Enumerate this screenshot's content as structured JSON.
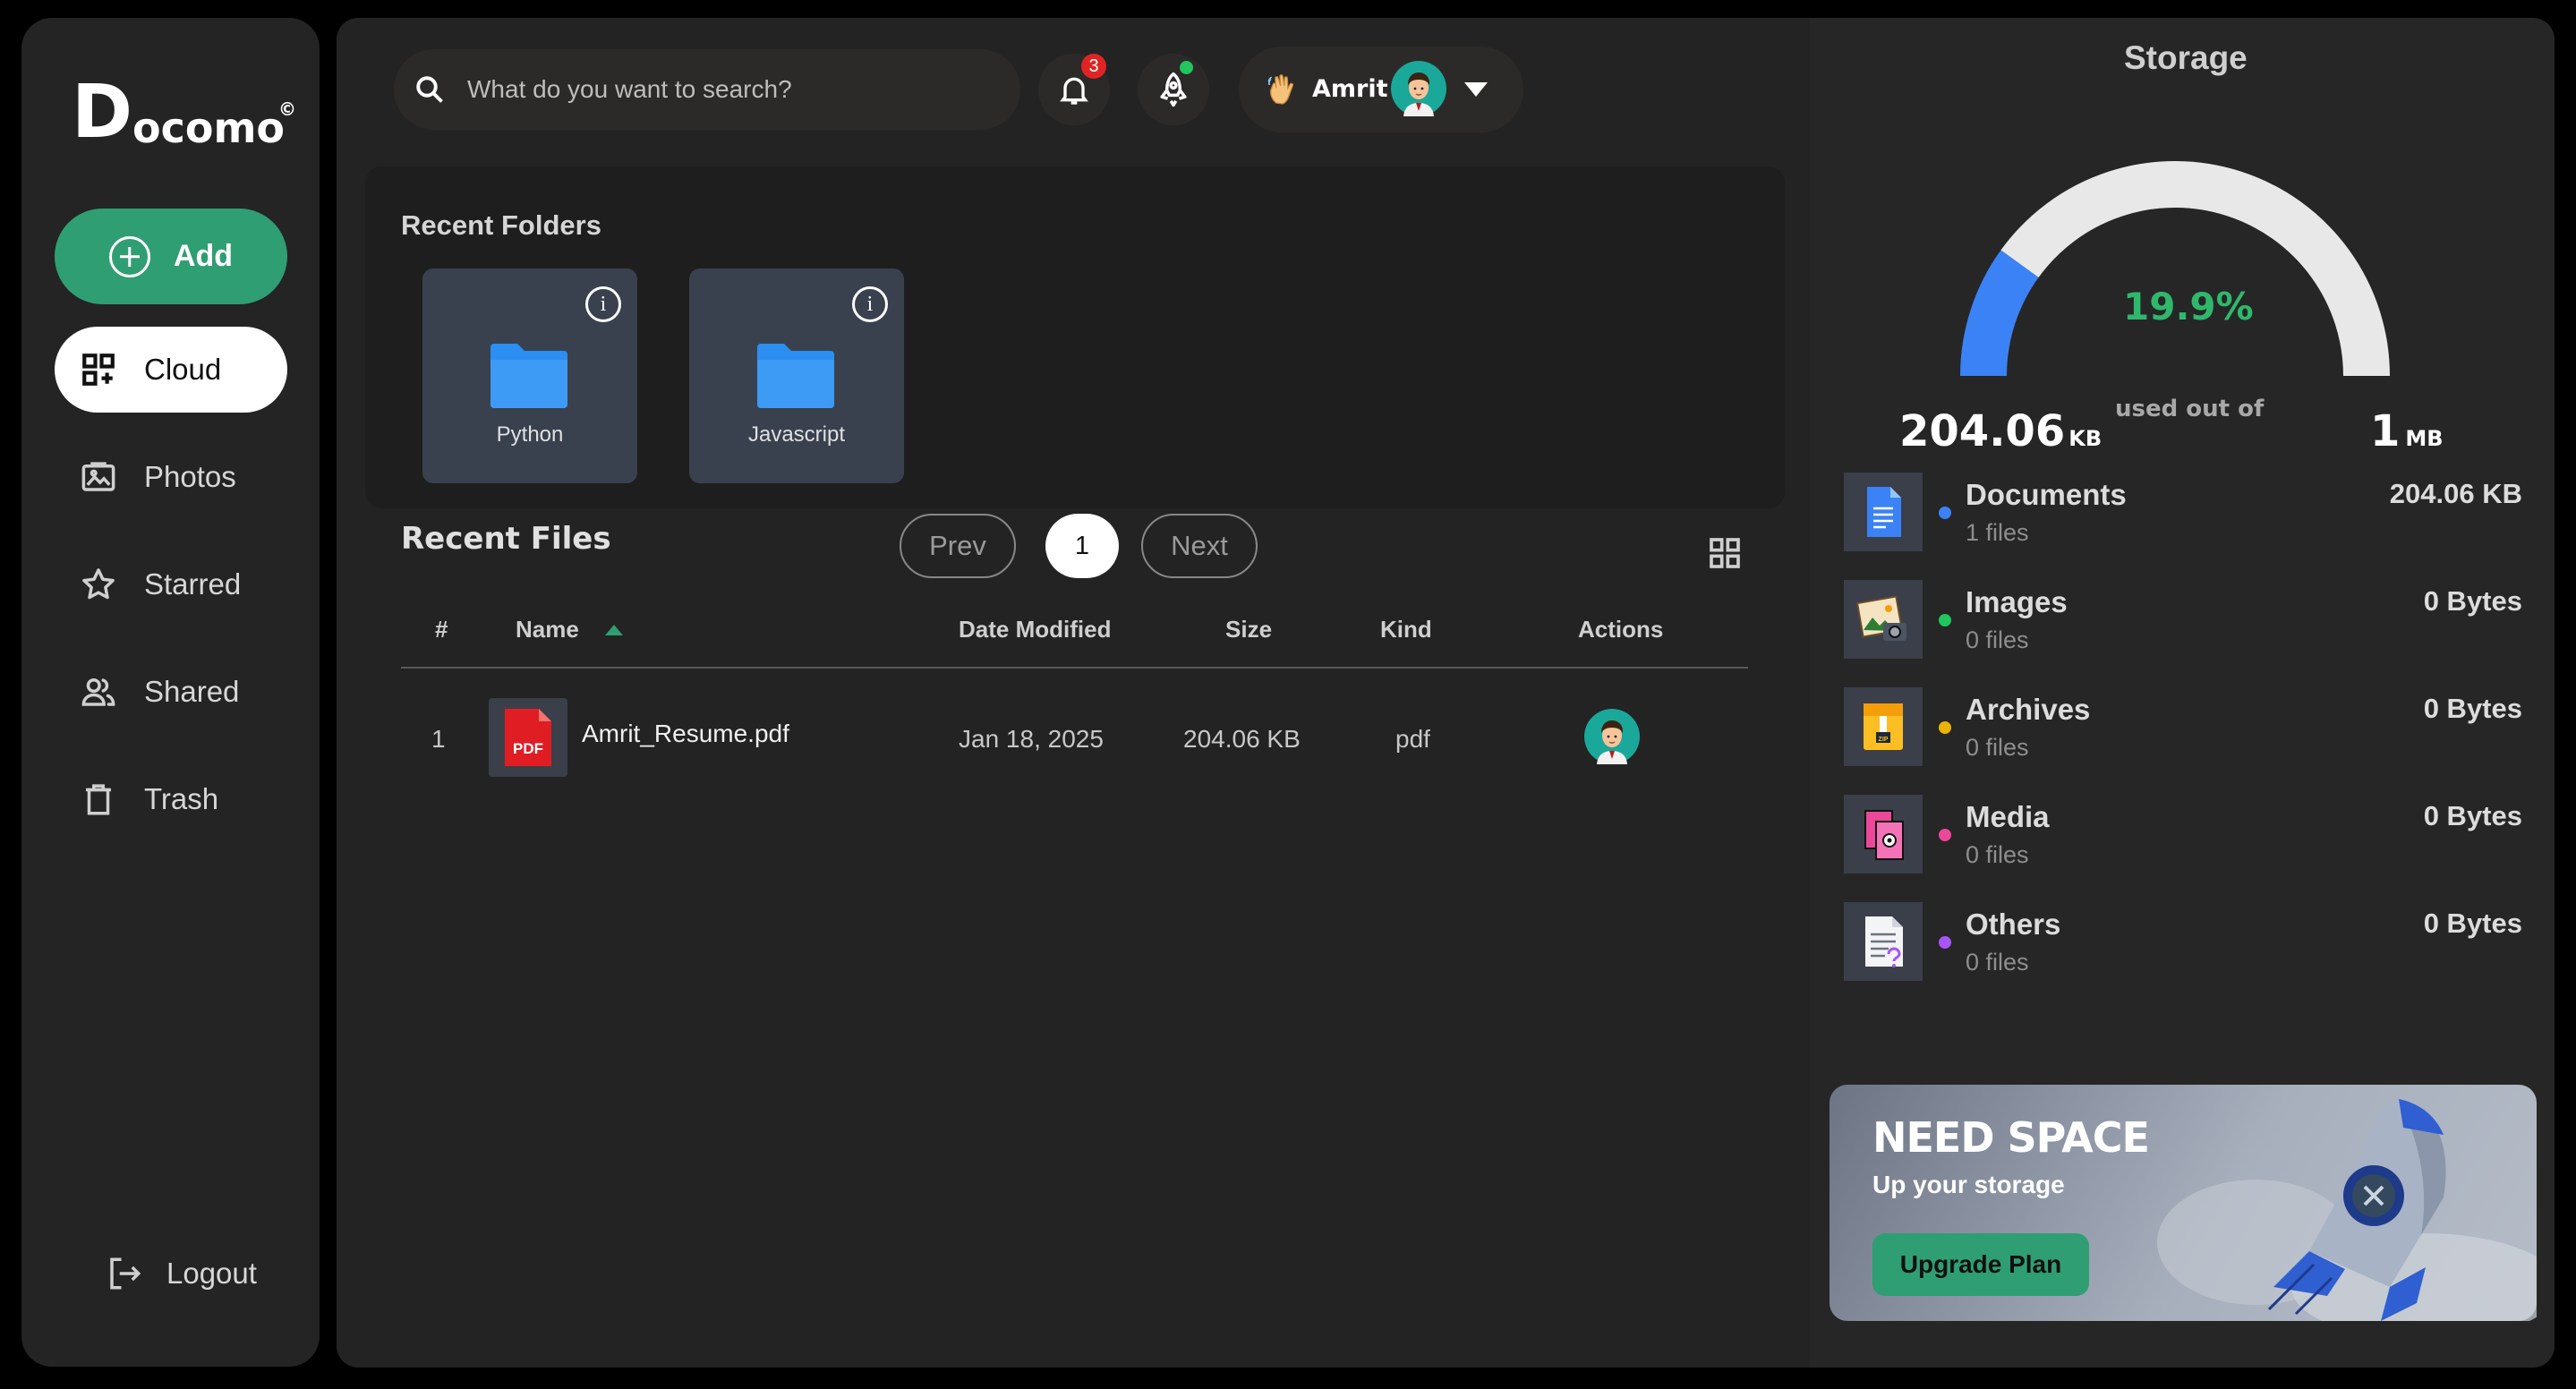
{
  "brand": {
    "logo_main": "D",
    "logo_rest": "ocomo",
    "logo_mark": "©"
  },
  "sidebar": {
    "add_label": "Add",
    "items": [
      {
        "label": "Cloud",
        "icon": "grid-plus-icon",
        "active": true
      },
      {
        "label": "Photos",
        "icon": "image-icon"
      },
      {
        "label": "Starred",
        "icon": "star-icon"
      },
      {
        "label": "Shared",
        "icon": "users-icon"
      },
      {
        "label": "Trash",
        "icon": "trash-icon"
      }
    ],
    "logout_label": "Logout"
  },
  "header": {
    "search_placeholder": "What do you want to search?",
    "notifications_count": "3",
    "user_greeting_icon": "waving-hand-icon",
    "user_name": "Amrit"
  },
  "recent_folders": {
    "title": "Recent Folders",
    "folders": [
      {
        "name": "Python"
      },
      {
        "name": "Javascript"
      }
    ]
  },
  "recent_files": {
    "title": "Recent Files",
    "pagination": {
      "prev": "Prev",
      "current": "1",
      "next": "Next"
    },
    "columns": [
      "#",
      "Name",
      "Date Modified",
      "Size",
      "Kind",
      "Actions"
    ],
    "rows": [
      {
        "index": "1",
        "name": "Amrit_Resume.pdf",
        "icon_label": "PDF",
        "date": "Jan 18, 2025",
        "size": "204.06 KB",
        "kind": "pdf"
      }
    ]
  },
  "storage": {
    "title": "Storage",
    "percent_label": "19.9%",
    "percent_value": 19.9,
    "used_caption": "used out of",
    "used_value": "204.06",
    "used_unit": "KB",
    "total_value": "1",
    "total_unit": "MB",
    "colors": {
      "used": "#3b82f6",
      "free": "#e8e8e8",
      "percent": "#2fb86b"
    },
    "categories": [
      {
        "name": "Documents",
        "count": "1 files",
        "size": "204.06 KB",
        "color": "#3b82f6",
        "icon": "document-icon"
      },
      {
        "name": "Images",
        "count": "0 files",
        "size": "0 Bytes",
        "color": "#22c55e",
        "icon": "image-file-icon"
      },
      {
        "name": "Archives",
        "count": "0 files",
        "size": "0 Bytes",
        "color": "#eab308",
        "icon": "zip-archive-icon"
      },
      {
        "name": "Media",
        "count": "0 files",
        "size": "0 Bytes",
        "color": "#ec4899",
        "icon": "media-film-icon"
      },
      {
        "name": "Others",
        "count": "0 files",
        "size": "0 Bytes",
        "color": "#a855f7",
        "icon": "other-file-icon"
      }
    ]
  },
  "upgrade": {
    "title": "NEED SPACE",
    "subtitle": "Up your storage",
    "button": "Upgrade Plan"
  },
  "theme": {
    "accent": "#2f9e73",
    "badge": "#e02424",
    "folder": "#2b8ef0"
  }
}
